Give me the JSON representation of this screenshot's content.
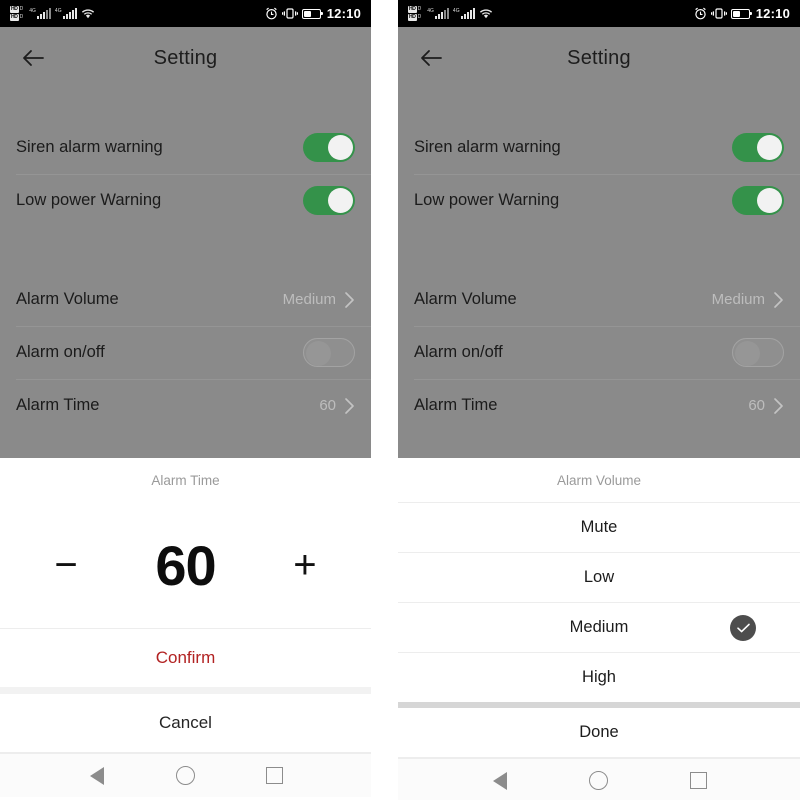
{
  "statusbar": {
    "hd_badge_label": "HD",
    "hd_sub_label": "D",
    "network_label": "4G",
    "wifi_icon": "wifi-icon",
    "alarm_icon": "alarm-clock-icon",
    "vibrate_icon": "vibrate-icon",
    "battery_icon": "battery-icon",
    "time": "12:10"
  },
  "header": {
    "back_icon": "back-arrow-icon",
    "title": "Setting"
  },
  "settings": {
    "toggle_rows": [
      {
        "label": "Siren alarm warning",
        "state": "on"
      },
      {
        "label": "Low power Warning",
        "state": "on"
      }
    ],
    "list_rows": [
      {
        "label": "Alarm Volume",
        "value": "Medium",
        "type": "chevron"
      },
      {
        "label": "Alarm on/off",
        "value": "",
        "type": "toggle",
        "state": "off"
      },
      {
        "label": "Alarm Time",
        "value": "60",
        "type": "chevron"
      }
    ]
  },
  "alarm_time_sheet": {
    "title": "Alarm Time",
    "decrement_label": "−",
    "value": "60",
    "increment_label": "+",
    "confirm_label": "Confirm",
    "cancel_label": "Cancel",
    "confirm_color": "#b22222"
  },
  "alarm_volume_sheet": {
    "title": "Alarm Volume",
    "options": [
      {
        "label": "Mute",
        "selected": false
      },
      {
        "label": "Low",
        "selected": false
      },
      {
        "label": "Medium",
        "selected": true
      },
      {
        "label": "High",
        "selected": false
      }
    ],
    "done_label": "Done",
    "check_icon": "check-circle-icon"
  },
  "navbar": {
    "back_icon": "nav-back-icon",
    "home_icon": "nav-home-icon",
    "recents_icon": "nav-recents-icon"
  },
  "colors": {
    "toggle_on": "#34924a",
    "dim_overlay": "#8a8a8a",
    "check_circle": "#4d4d4d"
  }
}
